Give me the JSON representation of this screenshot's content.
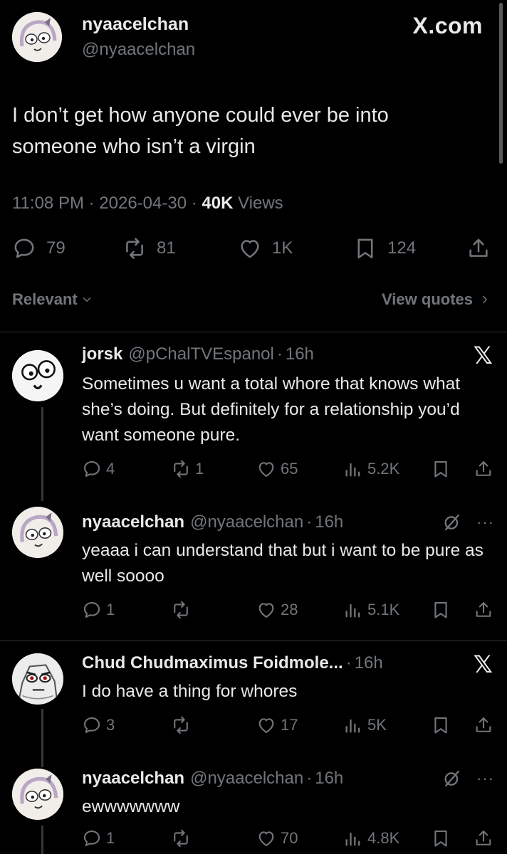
{
  "post": {
    "name": "nyaacelchan",
    "handle": "@nyaacelchan",
    "site_logo": "X.com",
    "text": "I don’t get how anyone could ever be into someone who isn’t a virgin",
    "time": "11:08 PM",
    "date": "2026-04-30",
    "views_count": "40K",
    "views_label": "Views",
    "actions": {
      "replies": "79",
      "reposts": "81",
      "likes": "1K",
      "bookmarks": "124"
    }
  },
  "filters": {
    "sort_label": "Relevant",
    "view_quotes_label": "View quotes"
  },
  "replies": [
    {
      "name": "jorsk",
      "handle": "@pChalTVEspanol",
      "time": "16h",
      "text": "Sometimes u want a total whore that knows what she’s doing. But definitely for a relationship you’d want someone pure.",
      "replies": "4",
      "reposts": "1",
      "likes": "65",
      "views": "5.2K",
      "badge_icon": "x-logo-icon"
    },
    {
      "name": "nyaacelchan",
      "handle": "@nyaacelchan",
      "time": "16h",
      "text": "yeaaa i can understand that but i want to be pure as well soooo",
      "replies": "1",
      "reposts": "",
      "likes": "28",
      "views": "5.1K",
      "badge_icon": "grok-icon"
    },
    {
      "name": "Chud Chudmaximus Foidmole...",
      "handle": "",
      "time": "16h",
      "text": "I do have a thing for whores",
      "replies": "3",
      "reposts": "",
      "likes": "17",
      "views": "5K",
      "badge_icon": "x-logo-icon"
    },
    {
      "name": "nyaacelchan",
      "handle": "@nyaacelchan",
      "time": "16h",
      "text": "ewwwwwww",
      "replies": "1",
      "reposts": "",
      "likes": "70",
      "views": "4.8K",
      "badge_icon": "grok-icon"
    }
  ],
  "colors": {
    "background": "#000000",
    "primary_text": "#e7e9ea",
    "secondary_text": "#71767b",
    "divider": "#2f3336"
  }
}
